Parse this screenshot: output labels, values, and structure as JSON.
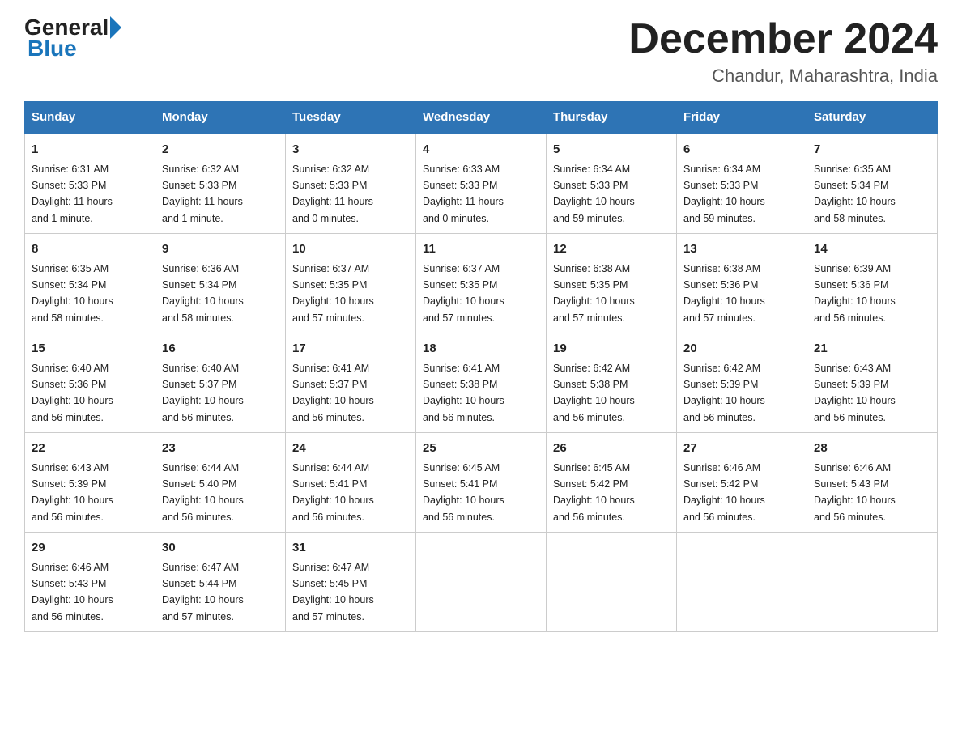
{
  "header": {
    "logo_general": "General",
    "logo_blue": "Blue",
    "month": "December 2024",
    "location": "Chandur, Maharashtra, India"
  },
  "days_of_week": [
    "Sunday",
    "Monday",
    "Tuesday",
    "Wednesday",
    "Thursday",
    "Friday",
    "Saturday"
  ],
  "weeks": [
    [
      {
        "day": "1",
        "info": "Sunrise: 6:31 AM\nSunset: 5:33 PM\nDaylight: 11 hours\nand 1 minute."
      },
      {
        "day": "2",
        "info": "Sunrise: 6:32 AM\nSunset: 5:33 PM\nDaylight: 11 hours\nand 1 minute."
      },
      {
        "day": "3",
        "info": "Sunrise: 6:32 AM\nSunset: 5:33 PM\nDaylight: 11 hours\nand 0 minutes."
      },
      {
        "day": "4",
        "info": "Sunrise: 6:33 AM\nSunset: 5:33 PM\nDaylight: 11 hours\nand 0 minutes."
      },
      {
        "day": "5",
        "info": "Sunrise: 6:34 AM\nSunset: 5:33 PM\nDaylight: 10 hours\nand 59 minutes."
      },
      {
        "day": "6",
        "info": "Sunrise: 6:34 AM\nSunset: 5:33 PM\nDaylight: 10 hours\nand 59 minutes."
      },
      {
        "day": "7",
        "info": "Sunrise: 6:35 AM\nSunset: 5:34 PM\nDaylight: 10 hours\nand 58 minutes."
      }
    ],
    [
      {
        "day": "8",
        "info": "Sunrise: 6:35 AM\nSunset: 5:34 PM\nDaylight: 10 hours\nand 58 minutes."
      },
      {
        "day": "9",
        "info": "Sunrise: 6:36 AM\nSunset: 5:34 PM\nDaylight: 10 hours\nand 58 minutes."
      },
      {
        "day": "10",
        "info": "Sunrise: 6:37 AM\nSunset: 5:35 PM\nDaylight: 10 hours\nand 57 minutes."
      },
      {
        "day": "11",
        "info": "Sunrise: 6:37 AM\nSunset: 5:35 PM\nDaylight: 10 hours\nand 57 minutes."
      },
      {
        "day": "12",
        "info": "Sunrise: 6:38 AM\nSunset: 5:35 PM\nDaylight: 10 hours\nand 57 minutes."
      },
      {
        "day": "13",
        "info": "Sunrise: 6:38 AM\nSunset: 5:36 PM\nDaylight: 10 hours\nand 57 minutes."
      },
      {
        "day": "14",
        "info": "Sunrise: 6:39 AM\nSunset: 5:36 PM\nDaylight: 10 hours\nand 56 minutes."
      }
    ],
    [
      {
        "day": "15",
        "info": "Sunrise: 6:40 AM\nSunset: 5:36 PM\nDaylight: 10 hours\nand 56 minutes."
      },
      {
        "day": "16",
        "info": "Sunrise: 6:40 AM\nSunset: 5:37 PM\nDaylight: 10 hours\nand 56 minutes."
      },
      {
        "day": "17",
        "info": "Sunrise: 6:41 AM\nSunset: 5:37 PM\nDaylight: 10 hours\nand 56 minutes."
      },
      {
        "day": "18",
        "info": "Sunrise: 6:41 AM\nSunset: 5:38 PM\nDaylight: 10 hours\nand 56 minutes."
      },
      {
        "day": "19",
        "info": "Sunrise: 6:42 AM\nSunset: 5:38 PM\nDaylight: 10 hours\nand 56 minutes."
      },
      {
        "day": "20",
        "info": "Sunrise: 6:42 AM\nSunset: 5:39 PM\nDaylight: 10 hours\nand 56 minutes."
      },
      {
        "day": "21",
        "info": "Sunrise: 6:43 AM\nSunset: 5:39 PM\nDaylight: 10 hours\nand 56 minutes."
      }
    ],
    [
      {
        "day": "22",
        "info": "Sunrise: 6:43 AM\nSunset: 5:39 PM\nDaylight: 10 hours\nand 56 minutes."
      },
      {
        "day": "23",
        "info": "Sunrise: 6:44 AM\nSunset: 5:40 PM\nDaylight: 10 hours\nand 56 minutes."
      },
      {
        "day": "24",
        "info": "Sunrise: 6:44 AM\nSunset: 5:41 PM\nDaylight: 10 hours\nand 56 minutes."
      },
      {
        "day": "25",
        "info": "Sunrise: 6:45 AM\nSunset: 5:41 PM\nDaylight: 10 hours\nand 56 minutes."
      },
      {
        "day": "26",
        "info": "Sunrise: 6:45 AM\nSunset: 5:42 PM\nDaylight: 10 hours\nand 56 minutes."
      },
      {
        "day": "27",
        "info": "Sunrise: 6:46 AM\nSunset: 5:42 PM\nDaylight: 10 hours\nand 56 minutes."
      },
      {
        "day": "28",
        "info": "Sunrise: 6:46 AM\nSunset: 5:43 PM\nDaylight: 10 hours\nand 56 minutes."
      }
    ],
    [
      {
        "day": "29",
        "info": "Sunrise: 6:46 AM\nSunset: 5:43 PM\nDaylight: 10 hours\nand 56 minutes."
      },
      {
        "day": "30",
        "info": "Sunrise: 6:47 AM\nSunset: 5:44 PM\nDaylight: 10 hours\nand 57 minutes."
      },
      {
        "day": "31",
        "info": "Sunrise: 6:47 AM\nSunset: 5:45 PM\nDaylight: 10 hours\nand 57 minutes."
      },
      {
        "day": "",
        "info": ""
      },
      {
        "day": "",
        "info": ""
      },
      {
        "day": "",
        "info": ""
      },
      {
        "day": "",
        "info": ""
      }
    ]
  ]
}
